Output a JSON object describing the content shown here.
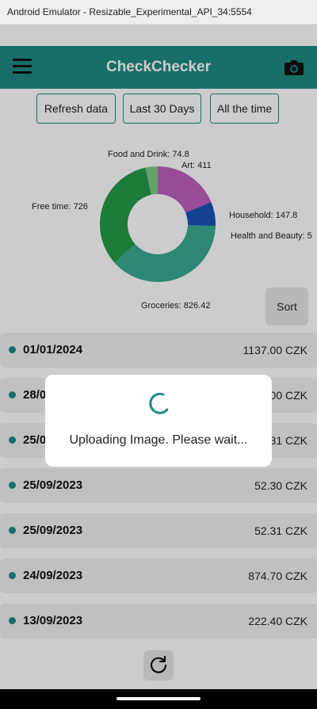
{
  "window": {
    "title": "Android Emulator - Resizable_Experimental_API_34:5554"
  },
  "appbar": {
    "title": "CheckChecker",
    "menu_icon": "hamburger-menu-icon",
    "camera_icon": "camera-icon"
  },
  "filters": {
    "refresh": "Refresh data",
    "last30": "Last 30 Days",
    "all_time": "All the time"
  },
  "chart_data": {
    "type": "pie",
    "style": "donut",
    "title": "",
    "slices": [
      {
        "label": "Art",
        "value": 411,
        "color": "#bf5fbd"
      },
      {
        "label": "Household",
        "value": 147.8,
        "color": "#1a53b5"
      },
      {
        "label": "Health and Beauty",
        "value": 5,
        "color": "#1fa3a0"
      },
      {
        "label": "Groceries",
        "value": 826.42,
        "color": "#3aab8f"
      },
      {
        "label": "Free time",
        "value": 726,
        "color": "#239a48"
      },
      {
        "label": "Food and Drink",
        "value": 74.8,
        "color": "#7fc98a"
      }
    ],
    "labels": {
      "food": "Food and Drink: 74.8",
      "art": "Art: 411",
      "free": "Free time: 726",
      "household": "Household: 147.8",
      "health": "Health and Beauty: 5",
      "groceries": "Groceries: 826.42"
    }
  },
  "sort_label": "Sort",
  "receipts": [
    {
      "date": "01/01/2024",
      "amount": "1137.00 CZK"
    },
    {
      "date": "28/0",
      "amount": "00 CZK"
    },
    {
      "date": "25/0",
      "amount": "31 CZK"
    },
    {
      "date": "25/09/2023",
      "amount": "52.30 CZK"
    },
    {
      "date": "25/09/2023",
      "amount": "52.31 CZK"
    },
    {
      "date": "24/09/2023",
      "amount": "874.70 CZK"
    },
    {
      "date": "13/09/2023",
      "amount": "222.40 CZK"
    }
  ],
  "refresh_icon": "refresh-icon",
  "dialog": {
    "message": "Uploading Image. Please wait...",
    "spinner_color": "#1f8a84"
  },
  "colors": {
    "primary": "#1f8a84",
    "row_background": "#f0f0f0"
  }
}
